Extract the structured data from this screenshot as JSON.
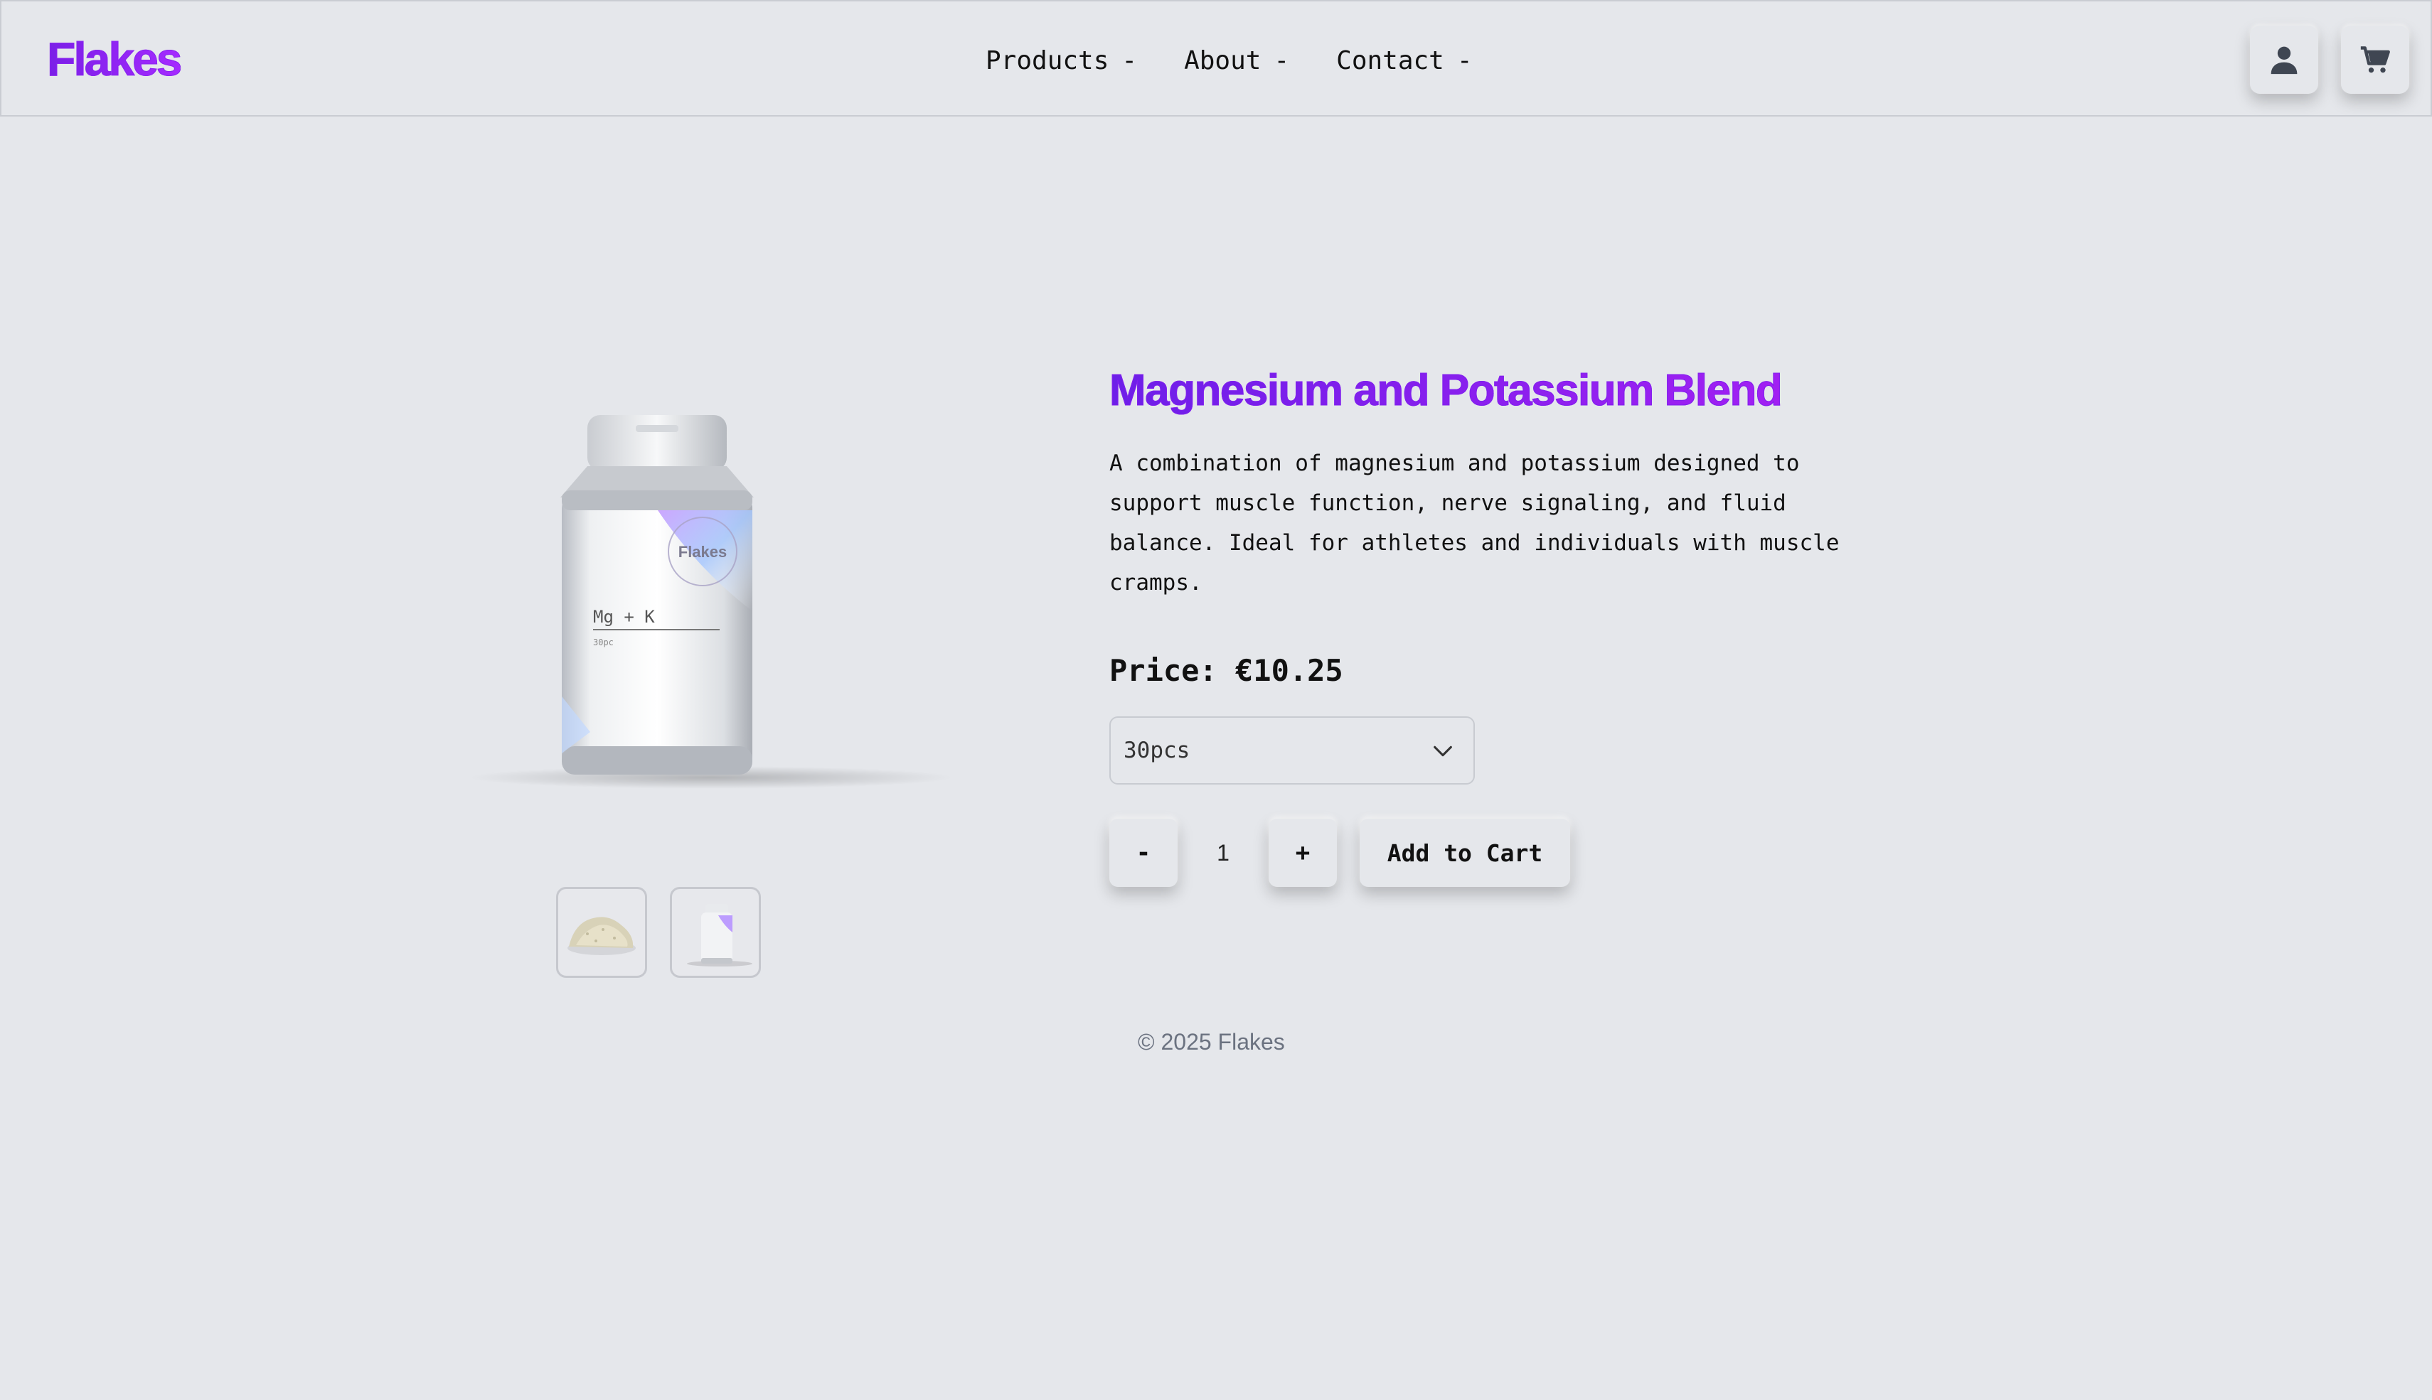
{
  "header": {
    "logo": "Flakes",
    "nav": [
      {
        "label": "Products",
        "marker": "-"
      },
      {
        "label": "About",
        "marker": "-"
      },
      {
        "label": "Contact",
        "marker": "-"
      }
    ],
    "icons": [
      "user-icon",
      "cart-icon"
    ]
  },
  "product": {
    "title": "Magnesium and Potassium Blend",
    "description": "A combination of magnesium and potassium designed to support muscle function, nerve signaling, and fluid balance. Ideal for athletes and individuals with muscle cramps.",
    "price": "Price: €10.25",
    "variant": "30pcs",
    "image": {
      "brand": "Flakes",
      "label": "Mg + K",
      "count": "30pc"
    },
    "thumbnails": [
      "powder-thumbnail",
      "jar-thumbnail"
    ]
  },
  "cart_controls": {
    "minus_label": "-",
    "quantity": "1",
    "plus_label": "+",
    "add_label": "Add to Cart"
  },
  "footer": {
    "copyright": "© 2025 Flakes"
  },
  "colors": {
    "background": "#e5e7eb",
    "accent_start": "#6d1fe8",
    "accent_end": "#b020f5",
    "footer_text": "#6b7280"
  }
}
